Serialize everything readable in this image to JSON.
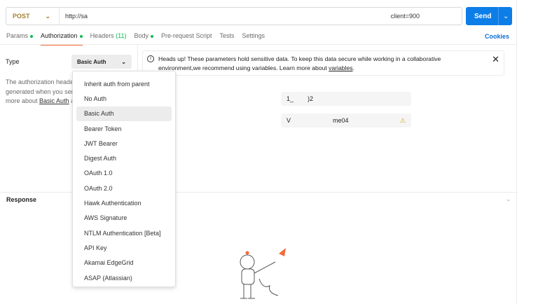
{
  "request": {
    "method": "POST",
    "url_start": "http://sa",
    "url_end": "client=900",
    "send_label": "Send"
  },
  "tabs": [
    {
      "label": "Params",
      "dot": true
    },
    {
      "label": "Authorization",
      "dot": true,
      "active": true
    },
    {
      "label": "Headers",
      "count": "(11)"
    },
    {
      "label": "Body",
      "dot": true
    },
    {
      "label": "Pre-request Script"
    },
    {
      "label": "Tests"
    },
    {
      "label": "Settings"
    }
  ],
  "cookies_label": "Cookies",
  "auth": {
    "type_label": "Type",
    "selected": "Basic Auth",
    "desc_lines": [
      "The authorization header",
      "generated when you send",
      "more about"
    ],
    "desc_link": "Basic Auth",
    "desc_tail": "au"
  },
  "info": {
    "text": "Heads up! These parameters hold sensitive data. To keep this data secure while working in a collaborative environment,we recommend using variables. Learn more about ",
    "link": "variables",
    "tail": "."
  },
  "fields": {
    "username": "1_        )2",
    "password_start": "V",
    "password_end": "me04"
  },
  "dropdown": [
    "Inherit auth from parent",
    "No Auth",
    "Basic Auth",
    "Bearer Token",
    "JWT Bearer",
    "Digest Auth",
    "OAuth 1.0",
    "OAuth 2.0",
    "Hawk Authentication",
    "AWS Signature",
    "NTLM Authentication [Beta]",
    "API Key",
    "Akamai EdgeGrid",
    "ASAP (Atlassian)"
  ],
  "response_label": "Response",
  "colors": {
    "accent": "#0d7ee8",
    "tab_underline": "#f26b3a",
    "method": "#a6822d"
  }
}
